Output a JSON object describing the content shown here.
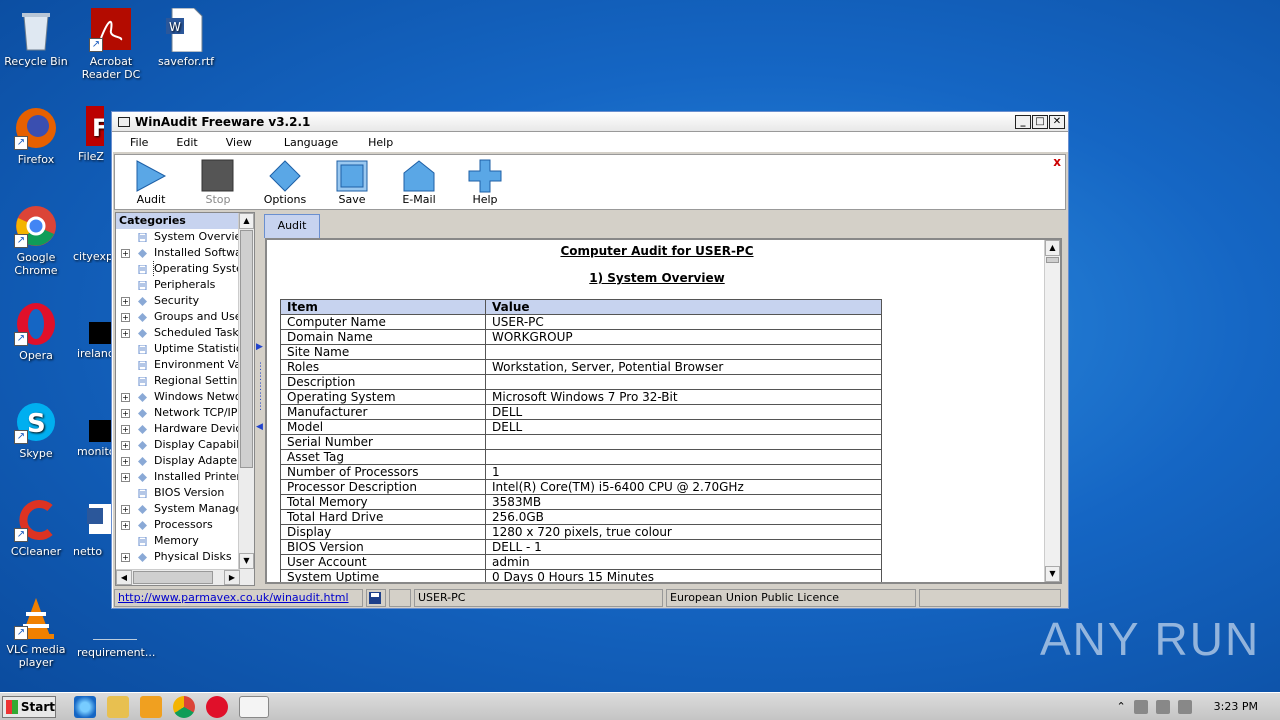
{
  "desktop": {
    "icons": [
      {
        "label": "Recycle Bin",
        "icon": "recycle-bin-icon"
      },
      {
        "label": "Acrobat Reader DC",
        "icon": "acrobat-reader-icon"
      },
      {
        "label": "savefor.rtf",
        "icon": "word-document-icon"
      },
      {
        "label": "Firefox",
        "icon": "firefox-icon"
      },
      {
        "label": "FileZilla",
        "icon": "filezilla-icon"
      },
      {
        "label": "Google Chrome",
        "icon": "chrome-icon"
      },
      {
        "label": "cityexp",
        "icon": "file-icon"
      },
      {
        "label": "Opera",
        "icon": "opera-icon"
      },
      {
        "label": "irelandy",
        "icon": "file-icon"
      },
      {
        "label": "Skype",
        "icon": "skype-icon"
      },
      {
        "label": "monito",
        "icon": "file-icon"
      },
      {
        "label": "CCleaner",
        "icon": "ccleaner-icon"
      },
      {
        "label": "netto",
        "icon": "word-document-icon"
      },
      {
        "label": "VLC media player",
        "icon": "vlc-icon"
      },
      {
        "label": "requirement...",
        "icon": "file-icon"
      }
    ],
    "watermark": "ANY RUN"
  },
  "window": {
    "title": "WinAudit Freeware v3.2.1",
    "menu": [
      "File",
      "Edit",
      "View",
      "Language",
      "Help"
    ],
    "toolbar": [
      {
        "label": "Audit",
        "icon": "play-icon"
      },
      {
        "label": "Stop",
        "icon": "stop-icon"
      },
      {
        "label": "Options",
        "icon": "diamond-icon"
      },
      {
        "label": "Save",
        "icon": "save-icon"
      },
      {
        "label": "E-Mail",
        "icon": "email-icon"
      },
      {
        "label": "Help",
        "icon": "plus-icon"
      }
    ],
    "toolbar_close": "x",
    "categories_header": "Categories",
    "categories": [
      {
        "label": "System Overview",
        "expandable": false
      },
      {
        "label": "Installed Software",
        "expandable": true
      },
      {
        "label": "Operating System",
        "expandable": false
      },
      {
        "label": "Peripherals",
        "expandable": false
      },
      {
        "label": "Security",
        "expandable": true
      },
      {
        "label": "Groups and Users",
        "expandable": true
      },
      {
        "label": "Scheduled Tasks",
        "expandable": true
      },
      {
        "label": "Uptime Statistics",
        "expandable": false
      },
      {
        "label": "Environment Variables",
        "expandable": false
      },
      {
        "label": "Regional Settings",
        "expandable": false
      },
      {
        "label": "Windows Network",
        "expandable": true
      },
      {
        "label": "Network TCP/IP",
        "expandable": true
      },
      {
        "label": "Hardware Devices",
        "expandable": true
      },
      {
        "label": "Display Capabilities",
        "expandable": true
      },
      {
        "label": "Display Adapters",
        "expandable": true
      },
      {
        "label": "Installed Printers",
        "expandable": true
      },
      {
        "label": "BIOS Version",
        "expandable": false
      },
      {
        "label": "System Management",
        "expandable": true
      },
      {
        "label": "Processors",
        "expandable": true
      },
      {
        "label": "Memory",
        "expandable": false
      },
      {
        "label": "Physical Disks",
        "expandable": true
      }
    ],
    "tab": "Audit",
    "report": {
      "title": "Computer Audit for USER-PC",
      "section": "1) System Overview",
      "headers": [
        "Item",
        "Value"
      ],
      "rows": [
        [
          "Computer Name",
          "USER-PC"
        ],
        [
          "Domain Name",
          "WORKGROUP"
        ],
        [
          "Site Name",
          ""
        ],
        [
          "Roles",
          "Workstation, Server, Potential Browser"
        ],
        [
          "Description",
          ""
        ],
        [
          "Operating System",
          "Microsoft Windows 7 Pro 32-Bit"
        ],
        [
          "Manufacturer",
          "DELL"
        ],
        [
          "Model",
          "DELL"
        ],
        [
          "Serial Number",
          ""
        ],
        [
          "Asset Tag",
          ""
        ],
        [
          "Number of Processors",
          "1"
        ],
        [
          "Processor Description",
          "Intel(R) Core(TM) i5-6400 CPU @ 2.70GHz"
        ],
        [
          "Total Memory",
          "3583MB"
        ],
        [
          "Total Hard Drive",
          "256.0GB"
        ],
        [
          "Display",
          "1280 x 720 pixels, true colour"
        ],
        [
          "BIOS Version",
          "DELL  - 1"
        ],
        [
          "User Account",
          "admin"
        ],
        [
          "System Uptime",
          "0 Days 0 Hours 15 Minutes"
        ]
      ]
    },
    "status": {
      "url": "http://www.parmavex.co.uk/winaudit.html",
      "computer": "USER-PC",
      "licence": "European Union Public Licence"
    }
  },
  "taskbar": {
    "start": "Start",
    "clock": "3:23 PM"
  }
}
